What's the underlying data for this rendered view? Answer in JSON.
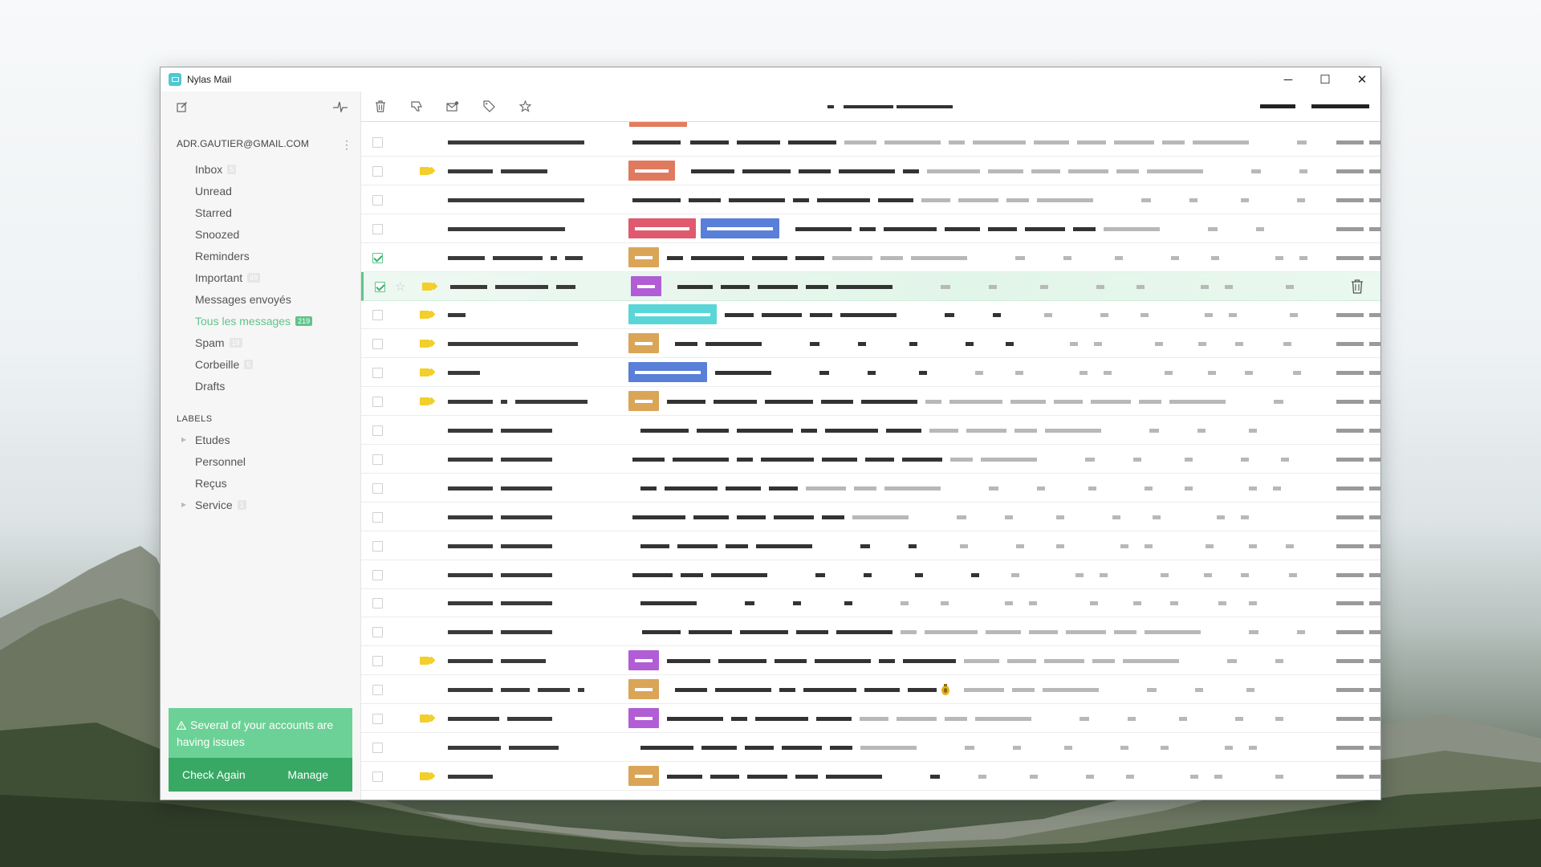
{
  "window": {
    "title": "Nylas Mail",
    "controls": {
      "minimize": "─",
      "maximize": "☐",
      "close": "✕"
    }
  },
  "toolbar": {
    "left_icons": [
      "compose-icon",
      "activity-icon"
    ],
    "action_icons": [
      "trash-icon",
      "thumbs-down-icon",
      "mark-unread-icon",
      "tag-icon",
      "star-icon"
    ]
  },
  "sidebar": {
    "account": "ADR.GAUTIER@GMAIL.COM",
    "folders": [
      {
        "label": "Inbox",
        "count": "5"
      },
      {
        "label": "Unread",
        "count": ""
      },
      {
        "label": "Starred",
        "count": ""
      },
      {
        "label": "Snoozed",
        "count": ""
      },
      {
        "label": "Reminders",
        "count": ""
      },
      {
        "label": "Important",
        "count": "49"
      },
      {
        "label": "Messages envoyés",
        "count": ""
      },
      {
        "label": "Tous les messages",
        "count": "219",
        "active": true
      },
      {
        "label": "Spam",
        "count": "19"
      },
      {
        "label": "Corbeille",
        "count": "5"
      },
      {
        "label": "Drafts",
        "count": ""
      }
    ],
    "labels_title": "LABELS",
    "labels": [
      {
        "label": "Etudes",
        "count": "",
        "expandable": true
      },
      {
        "label": "Personnel",
        "count": "",
        "expandable": false
      },
      {
        "label": "Reçus",
        "count": "",
        "expandable": false
      },
      {
        "label": "Service",
        "count": "1",
        "expandable": true
      }
    ]
  },
  "notice": {
    "message": "Several of your accounts are having issues",
    "check_again": "Check Again",
    "manage": "Manage"
  },
  "colors": {
    "accent": "#5fc48a",
    "notice": "#6cd196",
    "notice_dark": "#38a864",
    "tag_yellow": "#f2cf2a",
    "pill_orange": "#e07a5f",
    "pill_red": "#df5a6e",
    "pill_blue": "#5a7fd8",
    "pill_purple": "#b15dd6",
    "pill_teal": "#5ad6d8",
    "pill_gold": "#dba558"
  },
  "messages": [
    {
      "checked": false,
      "tag": false,
      "pills": []
    },
    {
      "checked": false,
      "tag": true,
      "pills": [
        "orange"
      ]
    },
    {
      "checked": false,
      "tag": false,
      "pills": []
    },
    {
      "checked": false,
      "tag": false,
      "pills": [
        "red",
        "blue"
      ]
    },
    {
      "checked": true,
      "tag": false,
      "pills": [
        "gold"
      ]
    },
    {
      "checked": true,
      "tag": true,
      "starred": false,
      "selected": true,
      "pills": [
        "purple"
      ]
    },
    {
      "checked": false,
      "tag": true,
      "pills": [
        "teal"
      ]
    },
    {
      "checked": false,
      "tag": true,
      "pills": [
        "gold"
      ]
    },
    {
      "checked": false,
      "tag": true,
      "pills": [
        "blue"
      ]
    },
    {
      "checked": false,
      "tag": true,
      "pills": [
        "gold"
      ]
    },
    {
      "checked": false,
      "tag": false,
      "pills": []
    },
    {
      "checked": false,
      "tag": false,
      "pills": []
    },
    {
      "checked": false,
      "tag": false,
      "pills": []
    },
    {
      "checked": false,
      "tag": false,
      "pills": []
    },
    {
      "checked": false,
      "tag": false,
      "pills": []
    },
    {
      "checked": false,
      "tag": false,
      "pills": []
    },
    {
      "checked": false,
      "tag": false,
      "pills": []
    },
    {
      "checked": false,
      "tag": false,
      "pills": []
    },
    {
      "checked": false,
      "tag": true,
      "pills": [
        "purple"
      ]
    },
    {
      "checked": false,
      "tag": false,
      "pills": [
        "gold"
      ],
      "attachment": true
    },
    {
      "checked": false,
      "tag": true,
      "pills": [
        "purple"
      ]
    },
    {
      "checked": false,
      "tag": false,
      "pills": []
    },
    {
      "checked": false,
      "tag": true,
      "pills": [
        "gold"
      ]
    }
  ]
}
